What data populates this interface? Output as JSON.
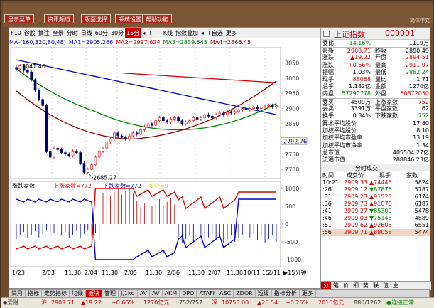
{
  "topbar": {
    "buttons": [
      "显示菜单",
      "资讯频道",
      "版面选择",
      "系统设置",
      "帮助功能"
    ],
    "right_text": "简体中文"
  },
  "toolbar": {
    "items": [
      "F10",
      "诊股",
      "摘注",
      "全景",
      "分时",
      "日线",
      "60分",
      "30分",
      "15分",
      "◂",
      "+",
      "−",
      "K线",
      "指数叠加",
      "◂",
      "+自选",
      "更多"
    ],
    "active_index": 8
  },
  "ma_legend": [
    {
      "label": "MA-(160,320,80,48)",
      "color": "#0000aa"
    },
    {
      "label": "MA1=2905.266",
      "color": "#0000cc"
    },
    {
      "label": "MA2=2997.624",
      "color": "#dd0000"
    },
    {
      "label": "MA3=2839.545",
      "color": "#008800"
    },
    {
      "label": "MA4=2866.45",
      "color": "#880000"
    }
  ],
  "chart": {
    "price_ticks": [
      3050,
      3000,
      2950,
      2900,
      2850,
      2800,
      2750,
      2700
    ],
    "price_range": [
      2670,
      3100
    ],
    "max_label": "3041.40",
    "min_label": "2685.27",
    "current_label": "2792.76",
    "lower_legend": {
      "title": "涨跌家数",
      "up_label": "上涨家数=772",
      "down_label": "下跌家数=772",
      "extra_label": "多空=0"
    },
    "lower_ticks": [
      1000,
      500,
      0,
      -500,
      -1000
    ],
    "date_labels": [
      "1/23",
      "2/03",
      "11:30",
      "2/04",
      "11:30",
      "2/05",
      "11:30",
      "2/06",
      "11:30",
      "2/07",
      "11:30",
      "10/11:15",
      "2/11"
    ],
    "right_marker": "▶15分钟"
  },
  "quote": {
    "name": "上证指数",
    "code": "000001",
    "pair_rows": [
      {
        "l": "委比",
        "v": "-14.16%",
        "vc": "grn",
        "l2": "",
        "v2": "1119万",
        "v2c": "blk"
      },
      {
        "l": "最新",
        "v": "2909.71",
        "vc": "red",
        "l2": "昨收",
        "v2": "2890.49",
        "v2c": "blk"
      },
      {
        "l": "涨跌",
        "v": "▲19.22",
        "vc": "red",
        "l2": "开盘",
        "v2": "2894.51",
        "v2c": "red"
      },
      {
        "l": "涨跌",
        "v": "+0.66%",
        "vc": "red",
        "l2": "最高",
        "v2": "2911.97",
        "v2c": "red"
      },
      {
        "l": "振幅",
        "v": "1.03%",
        "vc": "blk",
        "l2": "最低",
        "v2": "2882.24",
        "v2c": "grn"
      },
      {
        "l": "现手",
        "v": "88058",
        "vc": "red",
        "l2": "量比",
        "v2": "1.71",
        "v2c": "blk"
      },
      {
        "l": "总手",
        "v": "1.182亿",
        "vc": "blk",
        "l2": "金额",
        "v2": "1270亿",
        "v2c": "blk"
      },
      {
        "l": "内盘",
        "v": "57290778",
        "vc": "grn",
        "l2": "外盘",
        "v2": "60872050",
        "v2c": "red"
      },
      {
        "l": "委买",
        "v": "4509万",
        "vc": "blk",
        "l2": "上涨家数",
        "v2": "752",
        "v2c": "red"
      },
      {
        "l": "委卖",
        "v": "3391万",
        "vc": "blk",
        "l2": "平盘家数",
        "v2": "62",
        "v2c": "blk"
      },
      {
        "l": "换手",
        "v": "0.34%",
        "vc": "blk",
        "l2": "下跌家数",
        "v2": "752",
        "v2c": "grn"
      }
    ],
    "wide_rows": [
      {
        "l": "算术平均股价",
        "v": "17.80",
        "vc": "blk"
      },
      {
        "l": "加权平均股价",
        "v": "8.10",
        "vc": "blk"
      },
      {
        "l": "加权平均市盈率",
        "v": "13.19",
        "vc": "blk"
      },
      {
        "l": "加权平均市净率",
        "v": "1.34",
        "vc": "blk"
      },
      {
        "l": "总市值",
        "v": "405504.27亿",
        "vc": "blk"
      },
      {
        "l": "流通市值",
        "v": "288846.23亿",
        "vc": "blk"
      }
    ],
    "trade_title": "分时成交",
    "trade_tabs": [
      "时间",
      "成交价",
      "现手",
      "家数"
    ],
    "trades": [
      {
        "t": "10:21",
        "p": "2909.33",
        "q": "▲74446",
        "n": "5824"
      },
      {
        "t": ":26",
        "p": "2909.12",
        "q": "▼87875",
        "n": "5787"
      },
      {
        "t": ":31",
        "p": "2909.23",
        "q": "▲91523",
        "n": "6174"
      },
      {
        "t": ":36",
        "p": "2909.73",
        "q": "▲91076",
        "n": "6187"
      },
      {
        "t": ":41",
        "p": "2909.27",
        "q": "▼85300",
        "n": "5478"
      },
      {
        "t": ":46",
        "p": "2909.03",
        "q": "▼75145",
        "n": "4889"
      },
      {
        "t": ":51",
        "p": "2909.62",
        "q": "▲92605",
        "n": "6551"
      },
      {
        "t": ":56",
        "p": "2909.71",
        "q": "▲88058",
        "n": "5474"
      }
    ],
    "foot_tabs": [
      "分",
      "笔",
      "价",
      "细",
      "势",
      "联",
      "值",
      "主"
    ]
  },
  "bottom_tabs": [
    "简月",
    "指标",
    "走势指标",
    "均线",
    "板块",
    "管理",
    "J,1kd",
    "AV",
    "AV",
    "AKM",
    "DPO",
    "ATAFI",
    "ASC",
    "ZDOR",
    "短线",
    "指标分析",
    "更多"
  ],
  "bottom_active": 4,
  "status": {
    "logo": "◆爱财",
    "idx1_name": "沪",
    "idx1_price": "2909.71",
    "idx1_chg": "▲19.22",
    "idx1_pct": "+0.66%",
    "idx1_amt": "1270亿元",
    "idx1_updown": "752/752",
    "idx2_name": "深",
    "idx2_price": "10755.00",
    "idx2_chg": "▲26.54",
    "idx2_pct": "+0.25%",
    "idx2_amt": "2016亿元",
    "idx2_updown": "880/1262",
    "conn": "●连接正常"
  }
}
